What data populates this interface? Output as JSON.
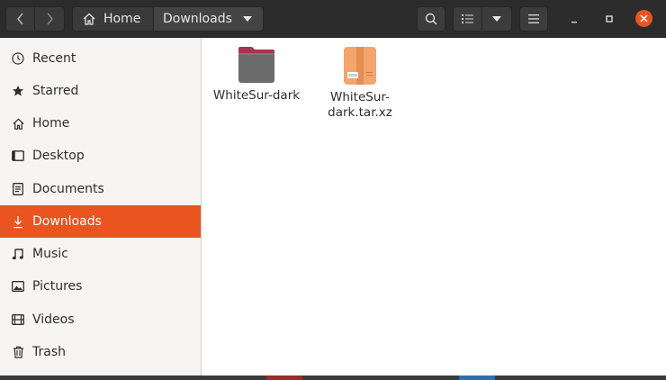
{
  "header": {
    "path": [
      {
        "label": "Home"
      },
      {
        "label": "Downloads"
      }
    ]
  },
  "sidebar": {
    "items": [
      {
        "label": "Recent",
        "icon": "clock-icon"
      },
      {
        "label": "Starred",
        "icon": "star-icon"
      },
      {
        "label": "Home",
        "icon": "home-icon"
      },
      {
        "label": "Desktop",
        "icon": "desktop-icon"
      },
      {
        "label": "Documents",
        "icon": "document-icon"
      },
      {
        "label": "Downloads",
        "icon": "download-icon",
        "active": true
      },
      {
        "label": "Music",
        "icon": "music-note-icon"
      },
      {
        "label": "Pictures",
        "icon": "picture-icon"
      },
      {
        "label": "Videos",
        "icon": "film-icon"
      },
      {
        "label": "Trash",
        "icon": "trash-icon"
      }
    ]
  },
  "files": [
    {
      "name": "WhiteSur-dark",
      "type": "folder"
    },
    {
      "name": "WhiteSur-dark.tar.xz",
      "type": "archive"
    }
  ],
  "colors": {
    "accent": "#e95420",
    "header_bg": "#2c2c2c",
    "sidebar_bg": "#f6f5f4",
    "folder_body": "#6b6b6b",
    "folder_tab": "#a8344e",
    "archive": "#f3a56d"
  }
}
